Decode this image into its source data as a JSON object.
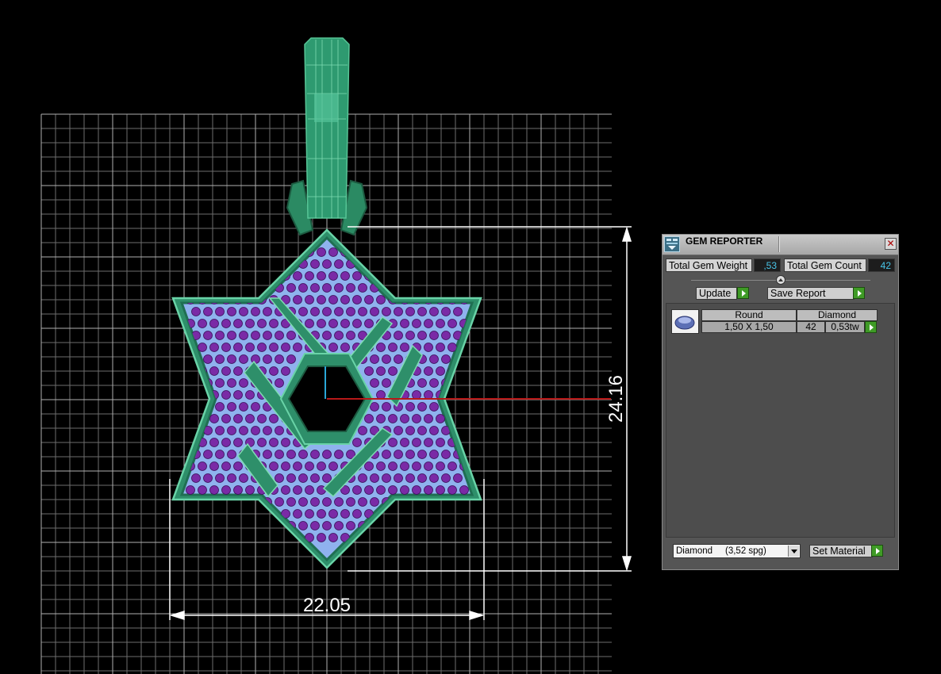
{
  "viewport": {
    "dimensions": {
      "width": "22.05",
      "height": "24.16"
    }
  },
  "gem_reporter": {
    "title": "GEM REPORTER",
    "close_glyph": "✕",
    "total_weight_label": "Total Gem Weight",
    "total_weight_value": ",53",
    "total_count_label": "Total Gem Count",
    "total_count_value": "42",
    "update_label": "Update",
    "save_report_label": "Save Report",
    "table": {
      "headers": [
        "Round",
        "Diamond"
      ],
      "row": {
        "size": "1,50 X 1,50",
        "count": "42",
        "weight": "0,53tw"
      }
    },
    "material_select": "Diamond     (3,52 spg)",
    "set_material_label": "Set Material"
  },
  "icons": [
    "app-icon",
    "close-icon",
    "gem-thumbnail-icon",
    "dropdown-arrow-icon",
    "green-arrow-icon"
  ],
  "colors": {
    "accent_value": "#48c5e8",
    "metal": "#2e8f6a",
    "stone": "#8fb2ee",
    "prong": "#7a2aa6",
    "green_button": "#3f9b26"
  }
}
